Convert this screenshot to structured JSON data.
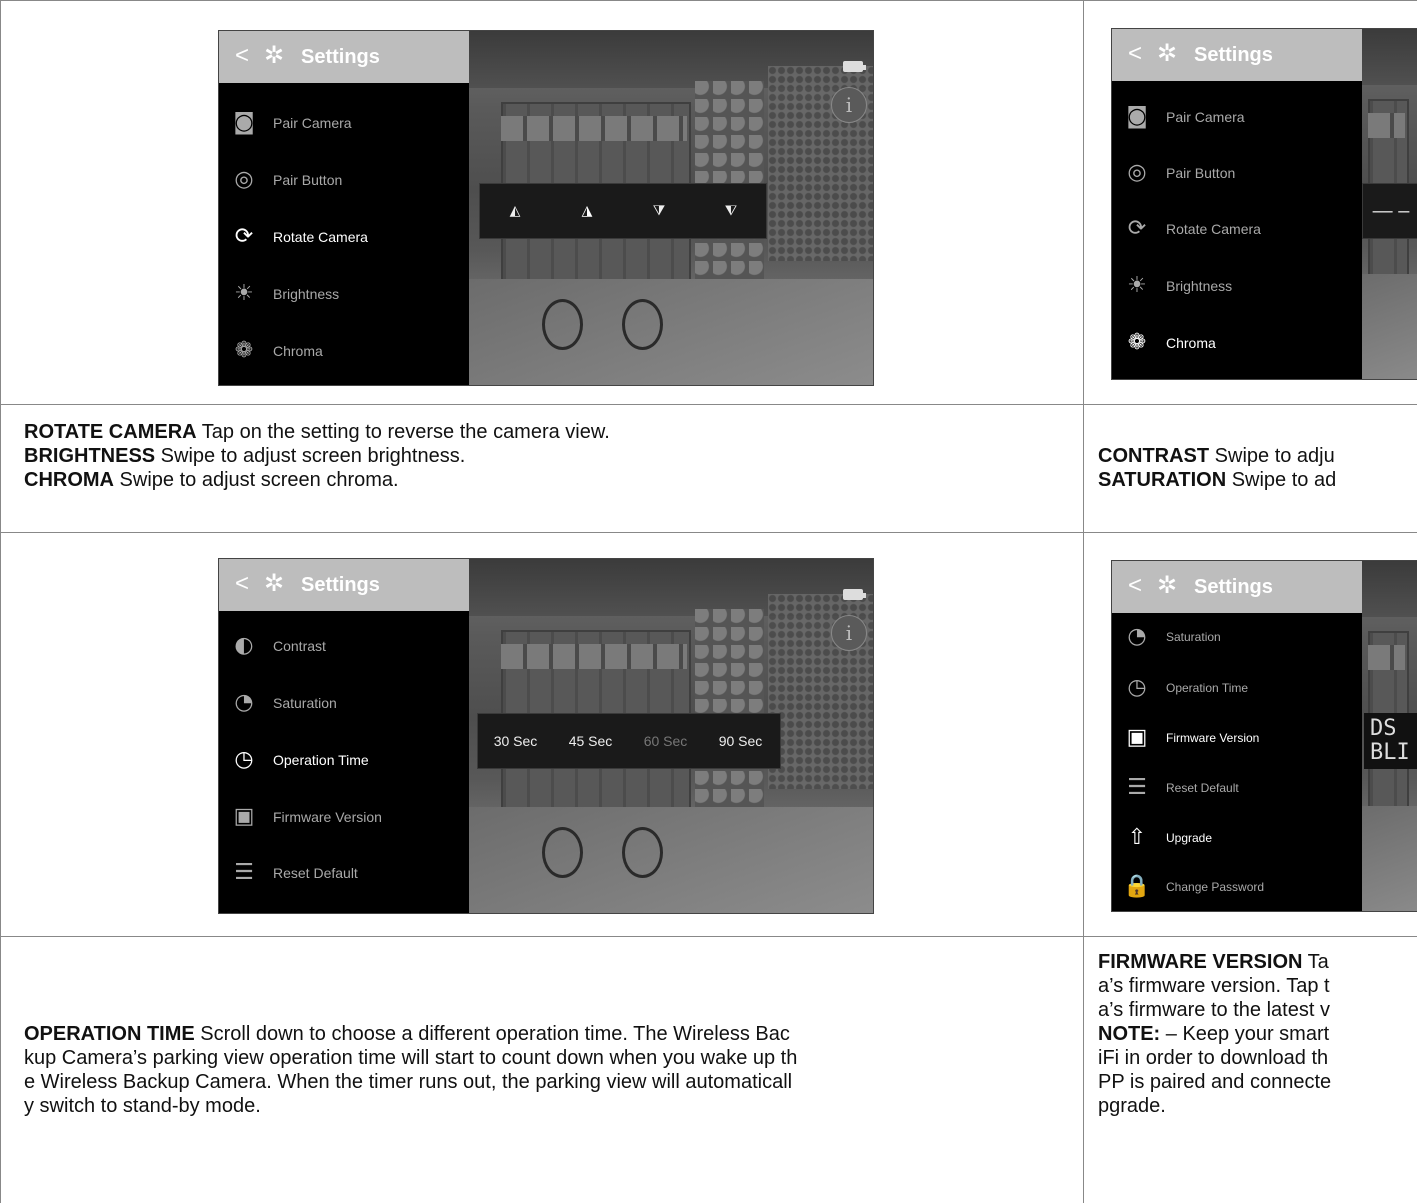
{
  "panels": {
    "p1": {
      "header_title": "Settings",
      "menu": [
        {
          "label": "Pair Camera",
          "icon": "pair-camera-icon"
        },
        {
          "label": "Pair Button",
          "icon": "pair-button-icon"
        },
        {
          "label": "Rotate Camera",
          "icon": "rotate-camera-icon",
          "active": true
        },
        {
          "label": "Brightness",
          "icon": "brightness-icon"
        },
        {
          "label": "Chroma",
          "icon": "chroma-icon"
        }
      ]
    },
    "p2": {
      "header_title": "Settings",
      "menu": [
        {
          "label": "Pair Camera",
          "icon": "pair-camera-icon"
        },
        {
          "label": "Pair Button",
          "icon": "pair-button-icon"
        },
        {
          "label": "Rotate Camera",
          "icon": "rotate-camera-icon"
        },
        {
          "label": "Brightness",
          "icon": "brightness-icon"
        },
        {
          "label": "Chroma",
          "icon": "chroma-icon",
          "active": true
        }
      ]
    },
    "p3": {
      "header_title": "Settings",
      "menu": [
        {
          "label": "Contrast",
          "icon": "contrast-icon"
        },
        {
          "label": "Saturation",
          "icon": "saturation-icon"
        },
        {
          "label": "Operation Time",
          "icon": "clock-icon",
          "active": true
        },
        {
          "label": "Firmware Version",
          "icon": "chip-icon"
        },
        {
          "label": "Reset Default",
          "icon": "sliders-icon"
        }
      ],
      "time_options": [
        "30 Sec",
        "45 Sec",
        "60 Sec",
        "90 Sec"
      ]
    },
    "p4": {
      "header_title": "Settings",
      "menu": [
        {
          "label": "Saturation",
          "icon": "saturation-icon"
        },
        {
          "label": "Operation Time",
          "icon": "clock-icon"
        },
        {
          "label": "Firmware Version",
          "icon": "chip-icon",
          "active": true
        },
        {
          "label": "Reset Default",
          "icon": "sliders-icon"
        },
        {
          "label": "Upgrade",
          "icon": "upgrade-icon",
          "active": true
        },
        {
          "label": "Change Password",
          "icon": "lock-icon"
        }
      ],
      "firmware_lines": [
        "DS",
        "BLI"
      ]
    }
  },
  "descriptions": {
    "d1": [
      {
        "term": "ROTATE CAMERA",
        "text": " Tap on the setting to reverse the camera view."
      },
      {
        "term": "BRIGHTNESS",
        "text": " Swipe to adjust screen brightness."
      },
      {
        "term": "CHROMA",
        "text": " Swipe to adjust screen chroma."
      }
    ],
    "d2": [
      {
        "term": "CONTRAST",
        "text": " Swipe to adju"
      },
      {
        "term": "SATURATION",
        "text": " Swipe to ad"
      }
    ],
    "d3": {
      "term": "OPERATION TIME",
      "lines": [
        " Scroll down to choose a different operation time. The Wireless Bac",
        "kup Camera’s parking view operation time will start to count down when you wake up th",
        "e Wireless Backup Camera. When the timer runs out, the parking view will automaticall",
        "y switch to stand-by mode."
      ]
    },
    "d4": {
      "firmware_term": "FIRMWARE VERSION",
      "firmware_tail": " Ta",
      "lines_a": [
        "a’s firmware version. Tap t",
        "a’s firmware to the latest v"
      ],
      "note_term": "NOTE:",
      "note_tail": " – Keep your smart",
      "lines_b": [
        "iFi in order to download th",
        "PP is paired and connecte",
        "pgrade."
      ]
    }
  }
}
